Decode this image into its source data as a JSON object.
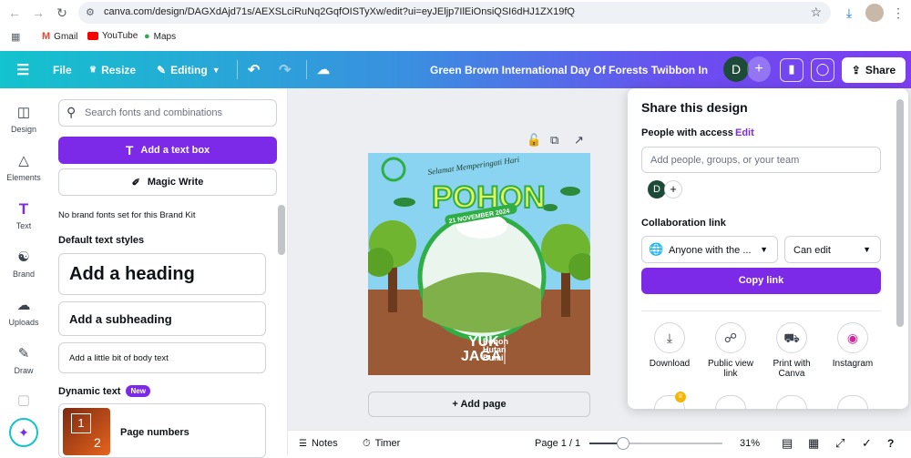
{
  "browser": {
    "url": "canva.com/design/DAGXdAjd71s/AEXSLciRuNq2GqfOISTyXw/edit?ui=eyJEljp7IlEiOnsiQSI6dHJ1ZX19fQ",
    "bookmarks": [
      {
        "label": "Gmail",
        "icon": "gmail-icon"
      },
      {
        "label": "YouTube",
        "icon": "youtube-icon"
      },
      {
        "label": "Maps",
        "icon": "maps-icon"
      }
    ]
  },
  "header": {
    "file": "File",
    "resize": "Resize",
    "editing": "Editing",
    "title": "Green Brown International Day Of Forests Twibbon Instagr...",
    "avatar": "D",
    "share": "Share"
  },
  "rail": [
    {
      "label": "Design",
      "icon": "design-icon"
    },
    {
      "label": "Elements",
      "icon": "elements-icon"
    },
    {
      "label": "Text",
      "icon": "text-icon"
    },
    {
      "label": "Brand",
      "icon": "brand-icon"
    },
    {
      "label": "Uploads",
      "icon": "uploads-icon"
    },
    {
      "label": "Draw",
      "icon": "draw-icon"
    }
  ],
  "panel": {
    "search_placeholder": "Search fonts and combinations",
    "add_textbox": "Add a text box",
    "magic_write": "Magic Write",
    "brand_note": "No brand fonts set for this Brand Kit",
    "default_styles": "Default text styles",
    "heading": "Add a heading",
    "subheading": "Add a subheading",
    "body": "Add a little bit of body text",
    "dynamic": "Dynamic text",
    "new_badge": "New",
    "page_numbers": "Page numbers",
    "pn_num1": "1",
    "pn_num2": "2"
  },
  "design": {
    "top_text": "Selamat Memperingati Hari",
    "main_text": "POHON",
    "date_text": "21 NOVEMBER 2024",
    "yuk": "YUK",
    "jaga": "JAGA",
    "bottom_lines": [
      "Pohon",
      "Hutan",
      "Bumi"
    ]
  },
  "canvas": {
    "add_page": "+ Add page"
  },
  "share": {
    "title": "Share this design",
    "people_label": "People with access",
    "edit": "Edit",
    "add_placeholder": "Add people, groups, or your team",
    "avatar": "D",
    "collab_label": "Collaboration link",
    "access": "Anyone with the ...",
    "permission": "Can edit",
    "copy": "Copy link",
    "options": [
      {
        "label": "Download",
        "icon": "download-icon"
      },
      {
        "label": "Public view link",
        "icon": "link-icon"
      },
      {
        "label": "Print with Canva",
        "icon": "truck-icon"
      },
      {
        "label": "Instagram",
        "icon": "instagram-icon"
      }
    ]
  },
  "bottom": {
    "notes": "Notes",
    "timer": "Timer",
    "page": "Page 1 / 1",
    "zoom": "31%",
    "zoom_level": 0.31
  }
}
